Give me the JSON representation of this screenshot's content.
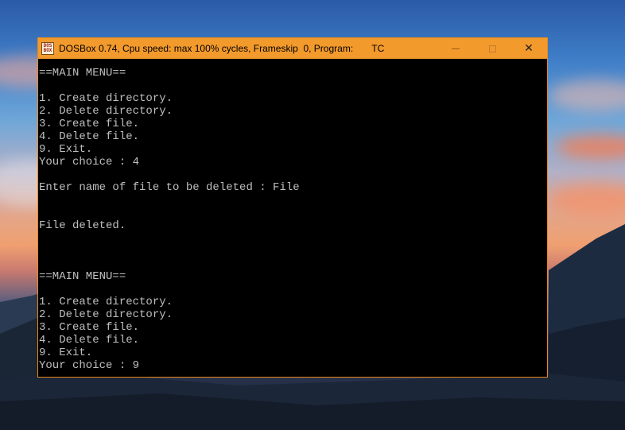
{
  "window": {
    "title": "DOSBox 0.74, Cpu speed: max 100% cycles, Frameskip  0, Program:       TC",
    "icon_label_top": "DOS",
    "icon_label_bottom": "BOX",
    "controls": [
      "minimize-icon",
      "maximize-icon",
      "close-icon"
    ],
    "close_glyph": "✕"
  },
  "console": {
    "lines": [
      "==MAIN MENU==",
      "",
      "1. Create directory.",
      "2. Delete directory.",
      "3. Create file.",
      "4. Delete file.",
      "9. Exit.",
      "Your choice : 4",
      "",
      "Enter name of file to be deleted : File",
      "",
      "",
      "File deleted.",
      "",
      "",
      "",
      "==MAIN MENU==",
      "",
      "1. Create directory.",
      "2. Delete directory.",
      "3. Create file.",
      "4. Delete file.",
      "9. Exit.",
      "Your choice : 9"
    ]
  },
  "colors": {
    "titlebar": "#f39a2c",
    "console_bg": "#000000",
    "console_text": "#bfbfbf"
  }
}
